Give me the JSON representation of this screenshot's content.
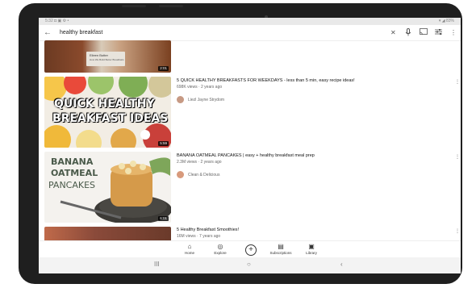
{
  "status_bar": {
    "left": "5:32 ◘ ▣ ⚙ •",
    "right": "▾ ◢ 83%"
  },
  "search": {
    "query": "healthy breakfast"
  },
  "icons": {
    "back": "arrow-back-icon",
    "clear": "close-icon",
    "mic": "mic-icon",
    "cast": "cast-icon",
    "filter": "filter-icon",
    "more": "more-vert-icon"
  },
  "videos": [
    {
      "duration": "2:01",
      "thumb_caption_line1": "Eileen Butter",
      "thumb_caption_line2": "How We Build Better Breakfasts"
    },
    {
      "title": "5 QUICK HEALTHY BREAKFASTS FOR WEEKDAYS - less than 5 min, easy recipe ideas!",
      "meta": "698K views · 2 years ago",
      "channel": "Liezl Jayne Strydom",
      "duration": "5:59",
      "thumb_text_line1": "QUICK HEALTHY",
      "thumb_text_line2": "BREAKFAST IDEAS"
    },
    {
      "title": "BANANA OATMEAL PANCAKES | easy + healthy breakfast meal prep",
      "meta": "2.3M views · 2 years ago",
      "channel": "Clean & Delicious",
      "duration": "6:01",
      "thumb_text_line1": "BANANA",
      "thumb_text_line2": "OATMEAL",
      "thumb_text_line3": "PANCAKES"
    },
    {
      "title": "5 Healthy Breakfast Smoothies!",
      "meta": "16M views · 7 years ago"
    }
  ],
  "bottom_nav": [
    {
      "label": "Home",
      "icon": "home-icon"
    },
    {
      "label": "Explore",
      "icon": "explore-icon"
    },
    {
      "label": "",
      "icon": "add-icon"
    },
    {
      "label": "Subscriptions",
      "icon": "subscriptions-icon"
    },
    {
      "label": "Library",
      "icon": "library-icon"
    }
  ],
  "system_nav": {
    "recents": "III",
    "home": "○",
    "back": "‹"
  }
}
